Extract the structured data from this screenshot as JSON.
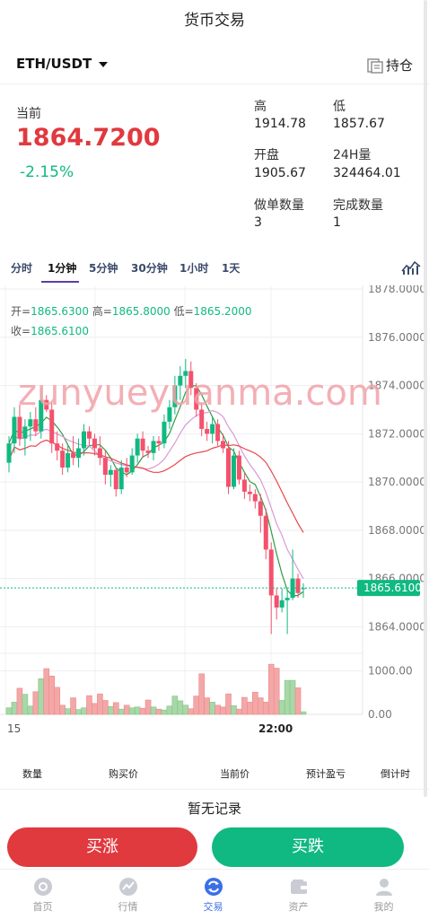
{
  "header": {
    "title": "货币交易"
  },
  "pair": {
    "symbol": "ETH/USDT",
    "hold_label": "持仓"
  },
  "quote": {
    "current_label": "当前",
    "price": "1864.7200",
    "change_pct": "-2.15%",
    "high_label": "高",
    "high": "1914.78",
    "low_label": "低",
    "low": "1857.67",
    "open_label": "开盘",
    "open": "1905.67",
    "vol_label": "24H量",
    "vol": "324464.01",
    "orders_label": "做单数量",
    "orders": "3",
    "done_label": "完成数量",
    "done": "1"
  },
  "tabs": [
    "分时",
    "1分钟",
    "5分钟",
    "30分钟",
    "1小时",
    "1天"
  ],
  "active_tab": 1,
  "legend": {
    "open_label": "开=",
    "open": "1865.6300",
    "high_label": "高=",
    "high": "1865.8000",
    "low_label": "低=",
    "low": "1865.2000",
    "close_label": "收=",
    "close": "1865.6100"
  },
  "watermark": "zunyueyuanma.com",
  "columns": [
    "数量",
    "购买价",
    "当前价",
    "预计盈亏",
    "倒计时"
  ],
  "no_record": "暂无记录",
  "buttons": {
    "up": "买涨",
    "down": "买跌"
  },
  "nav": [
    {
      "label": "首页",
      "icon": "home-icon"
    },
    {
      "label": "行情",
      "icon": "market-icon"
    },
    {
      "label": "交易",
      "icon": "trade-icon"
    },
    {
      "label": "资产",
      "icon": "wallet-icon"
    },
    {
      "label": "我的",
      "icon": "user-icon"
    }
  ],
  "colors": {
    "up": "#10b981",
    "down": "#f4516c",
    "accent": "#3b6fe6",
    "rise_btn": "#e0393e"
  },
  "chart_data": {
    "type": "candlestick",
    "price_ticks": [
      "1878.0000",
      "1876.0000",
      "1874.0000",
      "1872.0000",
      "1870.0000",
      "1868.0000",
      "1866.0000",
      "1864.0000"
    ],
    "price_range": [
      1862.9,
      1878.0
    ],
    "volume_ticks": [
      "1000.00",
      "0.00"
    ],
    "volume_range": [
      0,
      1400
    ],
    "x_labels": [
      "15",
      "22:00"
    ],
    "last_price": "1865.6100",
    "candles": [
      {
        "o": 1870.8,
        "h": 1871.9,
        "l": 1870.4,
        "c": 1871.6,
        "v": 150
      },
      {
        "o": 1871.6,
        "h": 1873.1,
        "l": 1871.2,
        "c": 1872.7,
        "v": 280
      },
      {
        "o": 1872.7,
        "h": 1873.2,
        "l": 1871.5,
        "c": 1871.8,
        "v": 600
      },
      {
        "o": 1871.8,
        "h": 1872.6,
        "l": 1871.1,
        "c": 1872.3,
        "v": 460
      },
      {
        "o": 1872.3,
        "h": 1872.9,
        "l": 1871.7,
        "c": 1872.6,
        "v": 190
      },
      {
        "o": 1872.6,
        "h": 1873.1,
        "l": 1871.9,
        "c": 1872.1,
        "v": 520
      },
      {
        "o": 1872.1,
        "h": 1873.9,
        "l": 1871.8,
        "c": 1873.4,
        "v": 820
      },
      {
        "o": 1873.4,
        "h": 1873.6,
        "l": 1872.9,
        "c": 1873.0,
        "v": 1050
      },
      {
        "o": 1873.0,
        "h": 1873.3,
        "l": 1871.2,
        "c": 1871.6,
        "v": 880
      },
      {
        "o": 1871.6,
        "h": 1872.1,
        "l": 1870.9,
        "c": 1871.3,
        "v": 620
      },
      {
        "o": 1871.3,
        "h": 1871.6,
        "l": 1870.3,
        "c": 1870.6,
        "v": 210
      },
      {
        "o": 1870.6,
        "h": 1871.5,
        "l": 1870.4,
        "c": 1871.2,
        "v": 130
      },
      {
        "o": 1871.2,
        "h": 1871.9,
        "l": 1870.7,
        "c": 1871.0,
        "v": 380
      },
      {
        "o": 1871.0,
        "h": 1871.8,
        "l": 1870.6,
        "c": 1871.4,
        "v": 110
      },
      {
        "o": 1871.4,
        "h": 1872.4,
        "l": 1871.1,
        "c": 1872.1,
        "v": 150
      },
      {
        "o": 1872.1,
        "h": 1872.3,
        "l": 1871.5,
        "c": 1871.8,
        "v": 430
      },
      {
        "o": 1871.8,
        "h": 1872.0,
        "l": 1871.1,
        "c": 1871.4,
        "v": 250
      },
      {
        "o": 1871.4,
        "h": 1871.9,
        "l": 1870.7,
        "c": 1871.0,
        "v": 470
      },
      {
        "o": 1871.0,
        "h": 1871.3,
        "l": 1869.9,
        "c": 1870.3,
        "v": 320
      },
      {
        "o": 1870.3,
        "h": 1870.7,
        "l": 1869.8,
        "c": 1870.5,
        "v": 180
      },
      {
        "o": 1870.5,
        "h": 1870.6,
        "l": 1869.4,
        "c": 1869.7,
        "v": 270
      },
      {
        "o": 1869.7,
        "h": 1870.9,
        "l": 1869.5,
        "c": 1870.6,
        "v": 120
      },
      {
        "o": 1870.6,
        "h": 1871.0,
        "l": 1870.2,
        "c": 1870.4,
        "v": 210
      },
      {
        "o": 1870.4,
        "h": 1871.4,
        "l": 1870.3,
        "c": 1871.1,
        "v": 150
      },
      {
        "o": 1871.1,
        "h": 1872.0,
        "l": 1870.8,
        "c": 1871.8,
        "v": 170
      },
      {
        "o": 1871.8,
        "h": 1872.1,
        "l": 1871.0,
        "c": 1871.3,
        "v": 140
      },
      {
        "o": 1871.3,
        "h": 1871.5,
        "l": 1871.0,
        "c": 1871.2,
        "v": 330
      },
      {
        "o": 1871.2,
        "h": 1871.9,
        "l": 1870.9,
        "c": 1871.7,
        "v": 170
      },
      {
        "o": 1871.7,
        "h": 1871.9,
        "l": 1871.3,
        "c": 1871.6,
        "v": 120
      },
      {
        "o": 1871.6,
        "h": 1872.8,
        "l": 1871.4,
        "c": 1872.5,
        "v": 100
      },
      {
        "o": 1872.5,
        "h": 1873.4,
        "l": 1872.2,
        "c": 1873.1,
        "v": 190
      },
      {
        "o": 1873.1,
        "h": 1874.4,
        "l": 1872.8,
        "c": 1874.0,
        "v": 420
      },
      {
        "o": 1874.0,
        "h": 1874.8,
        "l": 1873.4,
        "c": 1874.4,
        "v": 310
      },
      {
        "o": 1874.4,
        "h": 1875.1,
        "l": 1873.9,
        "c": 1874.6,
        "v": 210
      },
      {
        "o": 1874.6,
        "h": 1875.0,
        "l": 1873.6,
        "c": 1873.9,
        "v": 130
      },
      {
        "o": 1873.9,
        "h": 1874.1,
        "l": 1872.7,
        "c": 1873.0,
        "v": 420
      },
      {
        "o": 1873.0,
        "h": 1873.3,
        "l": 1871.9,
        "c": 1872.2,
        "v": 930
      },
      {
        "o": 1872.2,
        "h": 1872.5,
        "l": 1871.7,
        "c": 1872.0,
        "v": 380
      },
      {
        "o": 1872.0,
        "h": 1872.7,
        "l": 1871.6,
        "c": 1872.4,
        "v": 280
      },
      {
        "o": 1872.4,
        "h": 1872.6,
        "l": 1871.5,
        "c": 1871.7,
        "v": 210
      },
      {
        "o": 1871.7,
        "h": 1872.0,
        "l": 1871.2,
        "c": 1871.4,
        "v": 170
      },
      {
        "o": 1871.4,
        "h": 1871.7,
        "l": 1869.5,
        "c": 1869.8,
        "v": 470
      },
      {
        "o": 1869.8,
        "h": 1871.4,
        "l": 1869.7,
        "c": 1871.1,
        "v": 200
      },
      {
        "o": 1871.1,
        "h": 1871.3,
        "l": 1869.9,
        "c": 1870.1,
        "v": 120
      },
      {
        "o": 1870.1,
        "h": 1870.4,
        "l": 1869.3,
        "c": 1869.6,
        "v": 390
      },
      {
        "o": 1869.6,
        "h": 1869.9,
        "l": 1869.2,
        "c": 1869.5,
        "v": 280
      },
      {
        "o": 1869.5,
        "h": 1869.7,
        "l": 1868.9,
        "c": 1869.2,
        "v": 510
      },
      {
        "o": 1869.2,
        "h": 1869.5,
        "l": 1867.9,
        "c": 1868.6,
        "v": 380
      },
      {
        "o": 1868.6,
        "h": 1868.9,
        "l": 1866.8,
        "c": 1867.2,
        "v": 280
      },
      {
        "o": 1867.2,
        "h": 1867.5,
        "l": 1863.7,
        "c": 1865.3,
        "v": 1150
      },
      {
        "o": 1865.3,
        "h": 1865.6,
        "l": 1864.3,
        "c": 1864.8,
        "v": 1060
      },
      {
        "o": 1864.8,
        "h": 1865.6,
        "l": 1864.6,
        "c": 1865.1,
        "v": 320
      },
      {
        "o": 1865.1,
        "h": 1865.5,
        "l": 1863.7,
        "c": 1865.2,
        "v": 780
      },
      {
        "o": 1865.2,
        "h": 1867.2,
        "l": 1865.1,
        "c": 1866.0,
        "v": 780
      },
      {
        "o": 1866.0,
        "h": 1866.2,
        "l": 1865.2,
        "c": 1865.4,
        "v": 610
      },
      {
        "o": 1865.6,
        "h": 1865.8,
        "l": 1865.2,
        "c": 1865.6,
        "v": 60
      }
    ]
  }
}
